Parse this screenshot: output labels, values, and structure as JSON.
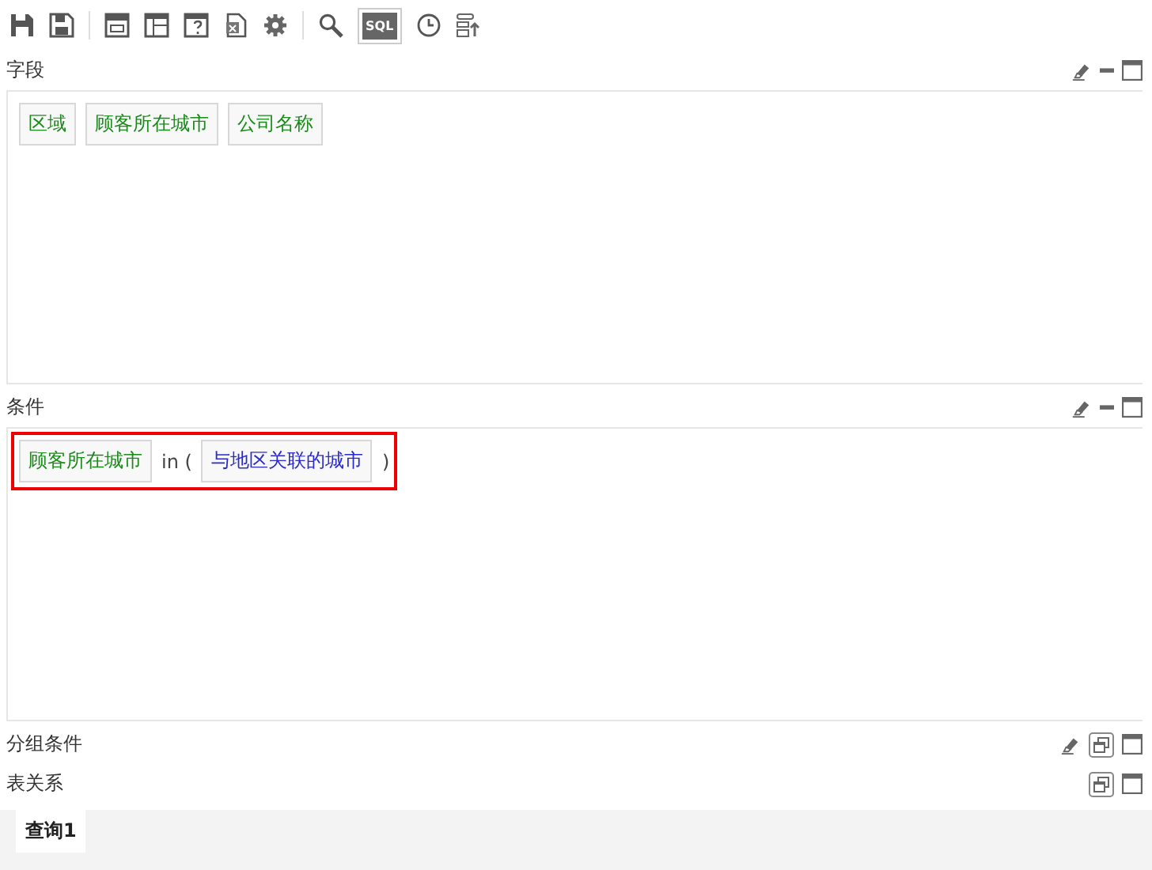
{
  "toolbar": {
    "sql_button": {
      "label": "SQL",
      "selected": true
    }
  },
  "sections": [
    {
      "title": "字段",
      "clearable": true,
      "expanded": true,
      "tokens": [
        {
          "kind": "field",
          "text": "区域"
        },
        {
          "kind": "field",
          "text": "顾客所在城市"
        },
        {
          "kind": "field",
          "text": "公司名称"
        }
      ]
    },
    {
      "title": "条件",
      "clearable": true,
      "expanded": true,
      "highlighted": true,
      "tokens": [
        {
          "kind": "field",
          "text": "顾客所在城市"
        },
        {
          "kind": "operator",
          "text": "in ("
        },
        {
          "kind": "param",
          "text": "与地区关联的城市"
        },
        {
          "kind": "operator",
          "text": ")"
        }
      ]
    },
    {
      "title": "分组条件",
      "clearable": true,
      "expanded": false
    },
    {
      "title": "表关系",
      "clearable": false,
      "expanded": false
    }
  ],
  "tabs": [
    {
      "label": "查询1",
      "selected": true
    }
  ]
}
